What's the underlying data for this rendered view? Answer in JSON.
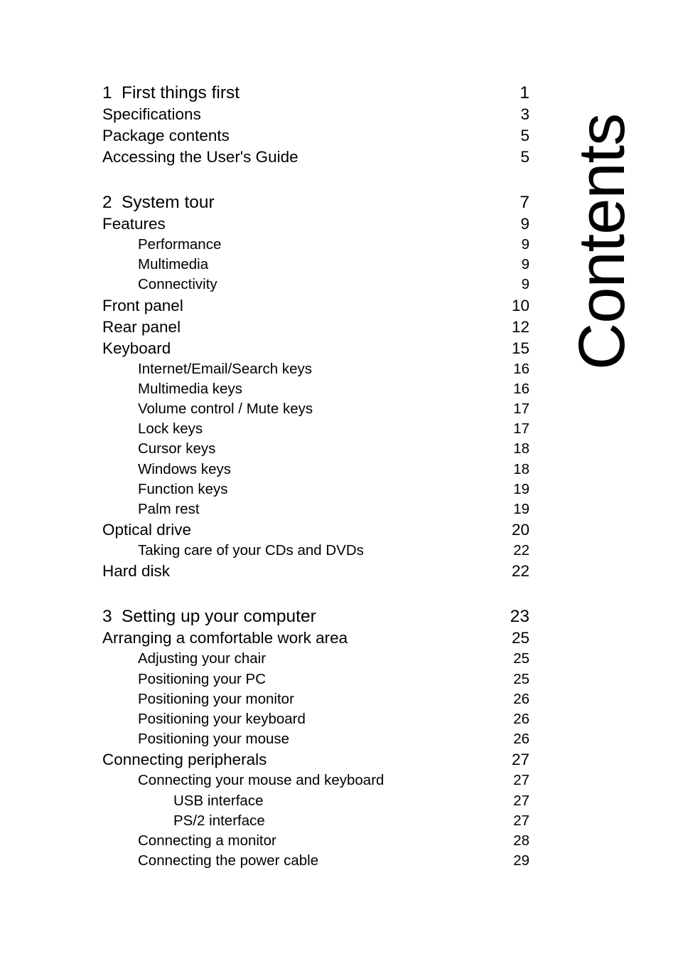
{
  "page": {
    "side_title": "Contents",
    "background_color": "#ffffff",
    "text_color": "#000000"
  },
  "toc": {
    "chapters": [
      {
        "number": "1",
        "title": "First things first",
        "page": "1",
        "entries": [
          {
            "level": 1,
            "title": "Specifications",
            "page": "3"
          },
          {
            "level": 1,
            "title": "Package contents",
            "page": "5"
          },
          {
            "level": 1,
            "title": "Accessing the User's Guide",
            "page": "5"
          }
        ]
      },
      {
        "number": "2",
        "title": "System tour",
        "page": "7",
        "entries": [
          {
            "level": 1,
            "title": "Features",
            "page": "9"
          },
          {
            "level": 2,
            "title": "Performance",
            "page": "9"
          },
          {
            "level": 2,
            "title": "Multimedia",
            "page": "9"
          },
          {
            "level": 2,
            "title": "Connectivity",
            "page": "9"
          },
          {
            "level": 1,
            "title": "Front panel",
            "page": "10"
          },
          {
            "level": 1,
            "title": "Rear panel",
            "page": "12"
          },
          {
            "level": 1,
            "title": "Keyboard",
            "page": "15"
          },
          {
            "level": 2,
            "title": "Internet/Email/Search keys",
            "page": "16"
          },
          {
            "level": 2,
            "title": "Multimedia keys",
            "page": "16"
          },
          {
            "level": 2,
            "title": "Volume control / Mute keys",
            "page": "17"
          },
          {
            "level": 2,
            "title": "Lock keys",
            "page": "17"
          },
          {
            "level": 2,
            "title": "Cursor keys",
            "page": "18"
          },
          {
            "level": 2,
            "title": "Windows keys",
            "page": "18"
          },
          {
            "level": 2,
            "title": "Function keys",
            "page": "19"
          },
          {
            "level": 2,
            "title": "Palm rest",
            "page": "19"
          },
          {
            "level": 1,
            "title": "Optical drive",
            "page": "20"
          },
          {
            "level": 2,
            "title": "Taking care of your CDs and DVDs",
            "page": "22"
          },
          {
            "level": 1,
            "title": "Hard disk",
            "page": "22"
          }
        ]
      },
      {
        "number": "3",
        "title": "Setting up your computer",
        "page": "23",
        "entries": [
          {
            "level": 1,
            "title": "Arranging a comfortable work area",
            "page": "25"
          },
          {
            "level": 2,
            "title": "Adjusting your chair",
            "page": "25"
          },
          {
            "level": 2,
            "title": "Positioning your PC",
            "page": "25"
          },
          {
            "level": 2,
            "title": "Positioning your monitor",
            "page": "26"
          },
          {
            "level": 2,
            "title": "Positioning your keyboard",
            "page": "26"
          },
          {
            "level": 2,
            "title": "Positioning your mouse",
            "page": "26"
          },
          {
            "level": 1,
            "title": "Connecting peripherals",
            "page": "27"
          },
          {
            "level": 2,
            "title": "Connecting your mouse and keyboard",
            "page": "27"
          },
          {
            "level": 3,
            "title": "USB interface",
            "page": "27"
          },
          {
            "level": 3,
            "title": "PS/2 interface",
            "page": "27"
          },
          {
            "level": 2,
            "title": "Connecting a monitor",
            "page": "28"
          },
          {
            "level": 2,
            "title": "Connecting the power cable",
            "page": "29"
          }
        ]
      }
    ]
  }
}
